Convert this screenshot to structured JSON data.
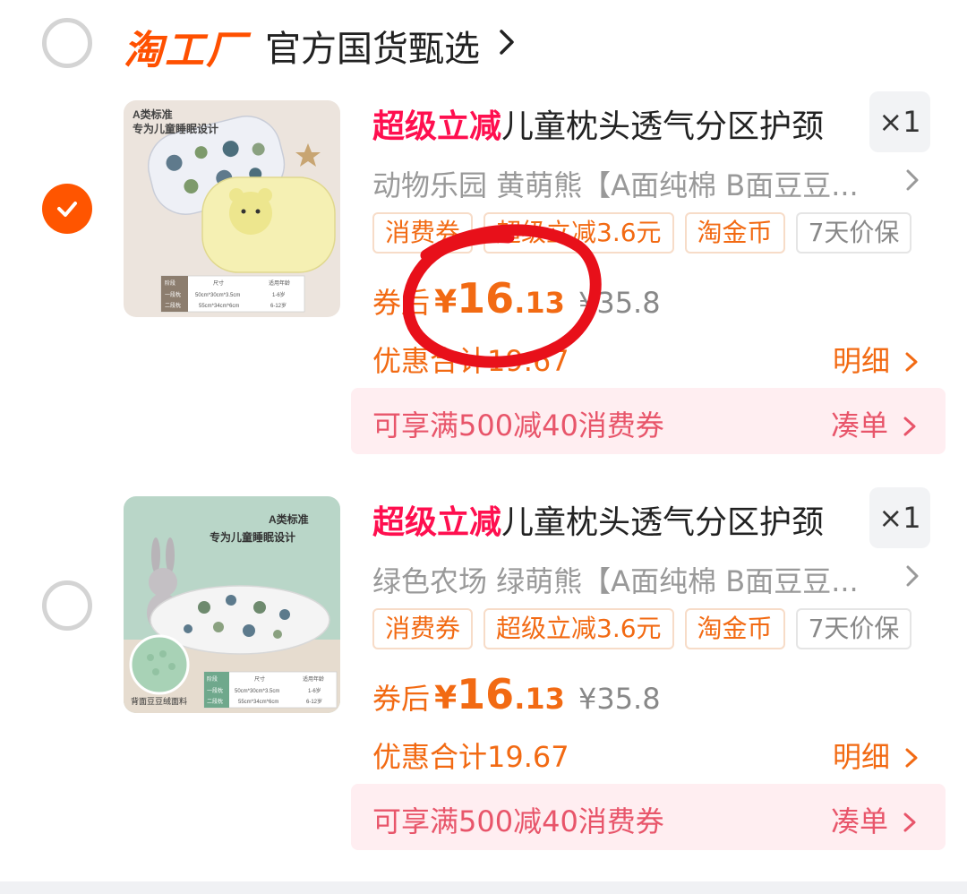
{
  "store": {
    "logo": "淘工厂",
    "name": "官方国货甄选",
    "selected": false
  },
  "items": [
    {
      "selected": true,
      "promo_tag": "超级立减",
      "title": "儿童枕头透气分区护颈",
      "qty": "×1",
      "sku": "动物乐园 黄萌熊【A面纯棉 B面豆豆...",
      "badges": [
        "消费券",
        "超级立减3.6元",
        "淘金币",
        "7天价保"
      ],
      "price_label": "券后",
      "price_yen": "¥",
      "price_int": "16",
      "price_dec": ".13",
      "orig_price": "¥35.8",
      "discount": "优惠合计19.67",
      "detail": "明细",
      "coupon": "可享满500减40消费券",
      "coupon_action": "凑单",
      "thumb": {
        "line1": "A类标准",
        "line2": "专为儿童睡眠设计",
        "table": [
          [
            "阶段",
            "尺寸",
            "适用年龄"
          ],
          [
            "一段枕",
            "50cm*30cm*3.5cm",
            "1-6岁"
          ],
          [
            "二段枕",
            "55cm*34cm*6cm",
            "6-12岁"
          ]
        ]
      }
    },
    {
      "selected": false,
      "promo_tag": "超级立减",
      "title": "儿童枕头透气分区护颈",
      "qty": "×1",
      "sku": "绿色农场 绿萌熊【A面纯棉 B面豆豆...",
      "badges": [
        "消费券",
        "超级立减3.6元",
        "淘金币",
        "7天价保"
      ],
      "price_label": "券后",
      "price_yen": "¥",
      "price_int": "16",
      "price_dec": ".13",
      "orig_price": "¥35.8",
      "discount": "优惠合计19.67",
      "detail": "明细",
      "coupon": "可享满500减40消费券",
      "coupon_action": "凑单",
      "thumb": {
        "line1": "A类标准",
        "line2": "专为儿童睡眠设计",
        "caption": "背面豆豆绒面料",
        "table": [
          [
            "阶段",
            "尺寸",
            "适用年龄"
          ],
          [
            "一段枕",
            "50cm*30cm*3.5cm",
            "1-6岁"
          ],
          [
            "二段枕",
            "55cm*34cm*6cm",
            "6-12岁"
          ]
        ]
      }
    }
  ],
  "colors": {
    "accent": "#ff5500",
    "price": "#f26a13",
    "promo": "#ff0f4f",
    "coupon_bg": "#ffeef1",
    "coupon_text": "#e8556a",
    "annotation": "#e8101a"
  }
}
